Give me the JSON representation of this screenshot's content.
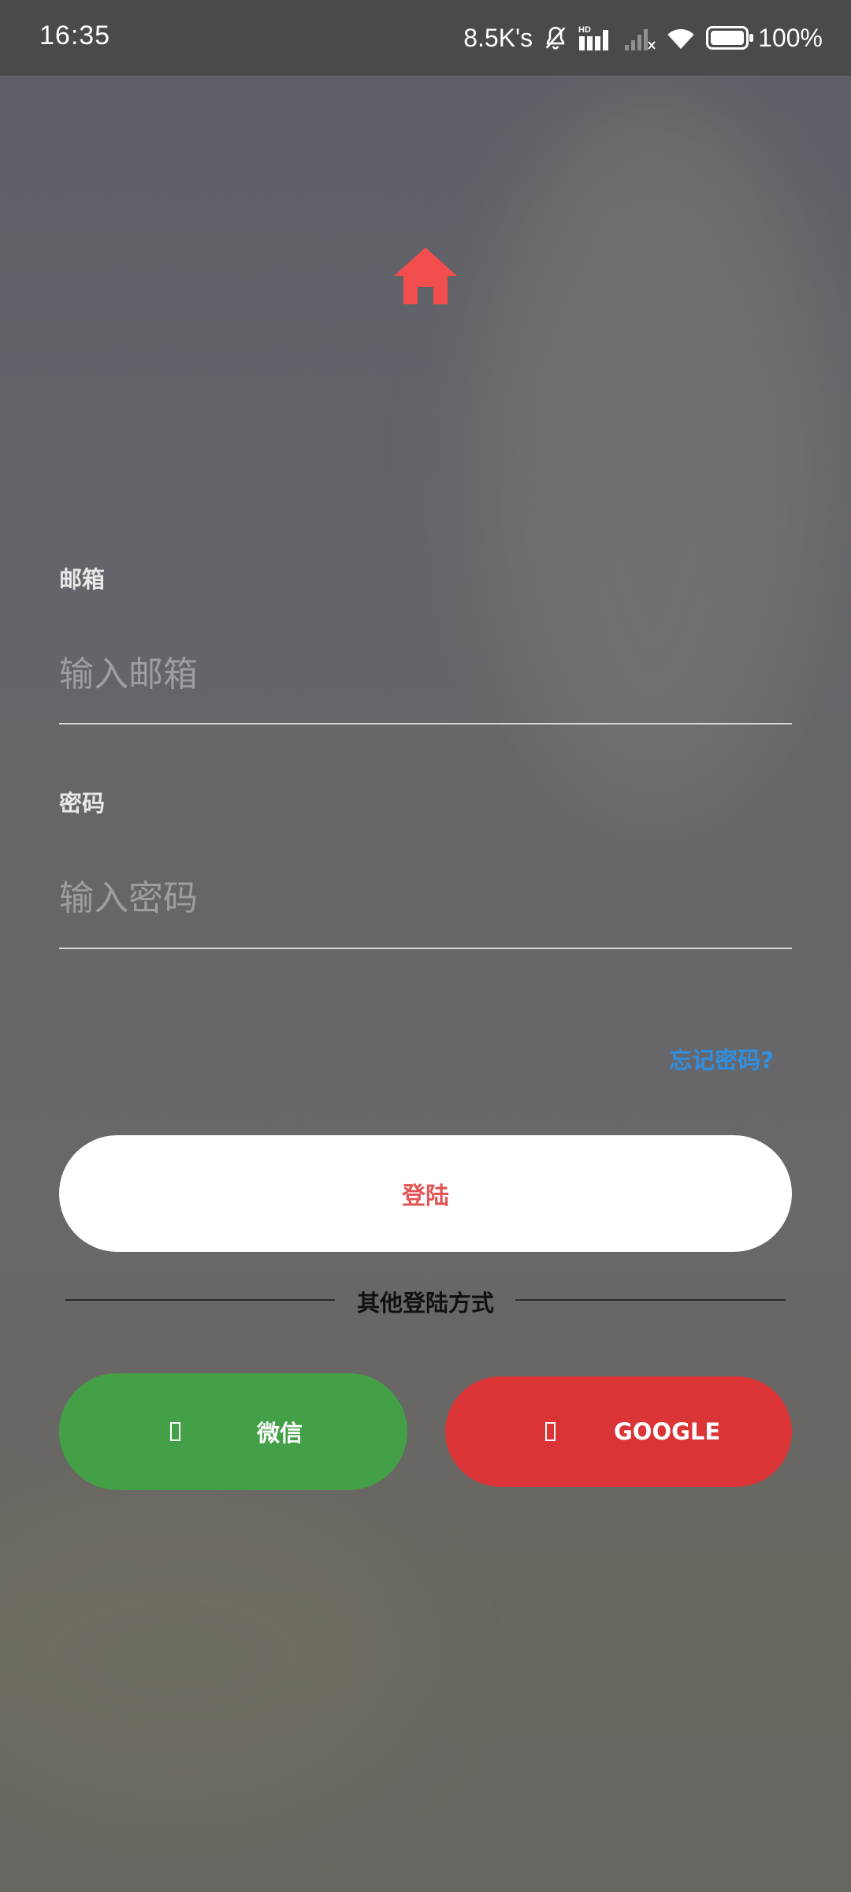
{
  "status_bar": {
    "time": "16:35",
    "network_speed": "8.5K's",
    "battery_percent": "100%"
  },
  "header": {
    "logo_icon": "home-icon",
    "logo_color": "#f24e4e"
  },
  "form": {
    "email": {
      "label": "邮箱",
      "placeholder": "输入邮箱",
      "value": ""
    },
    "password": {
      "label": "密码",
      "placeholder": "输入密码",
      "value": ""
    },
    "forgot_password": "忘记密码?",
    "login_button": "登陆"
  },
  "other_login": {
    "divider_text": "其他登陆方式",
    "wechat": {
      "label": "微信",
      "icon": "wechat-icon",
      "color": "#43a047"
    },
    "google": {
      "label": "GOOGLE",
      "icon": "google-icon",
      "color": "#da3437"
    }
  }
}
